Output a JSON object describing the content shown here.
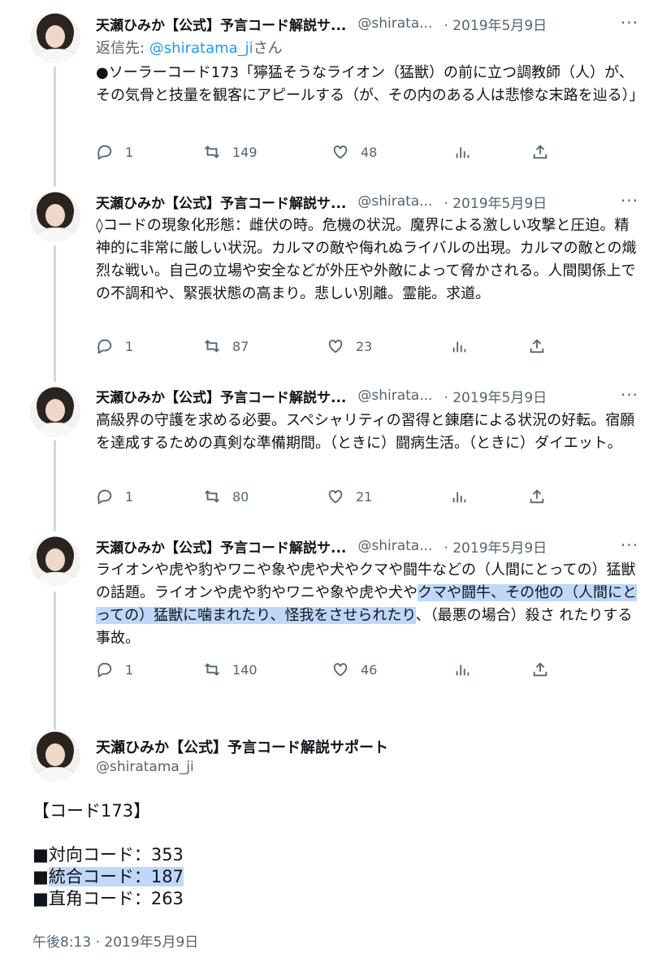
{
  "tweets": [
    {
      "name": "天瀬ひみか【公式】予言コード解説サ...",
      "handle": "@shirata...",
      "date": "· 2019年5月9日",
      "reply_prefix": "返信先: ",
      "reply_mention": "@shiratama_ji",
      "reply_suffix": "さん",
      "text": "●ソーラーコード173「獰猛そうなライオン（猛獣）の前に立つ調教師（人）が、その気骨と技量を観客にアピールする（が、その内のある人は悲惨な末路を辿る）」",
      "replies": "1",
      "retweets": "149",
      "likes": "48"
    },
    {
      "name": "天瀬ひみか【公式】予言コード解説サ...",
      "handle": "@shirata...",
      "date": "· 2019年5月9日",
      "text": "◊コードの現象化形態：雌伏の時。危機の状況。魔界による激しい攻撃と圧迫。精神的に非常に厳しい状況。カルマの敵や侮れぬライバルの出現。カルマの敵との熾烈な戦い。自己の立場や安全などが外圧や外敵によって脅かされる。人間関係上での不調和や、緊張状態の高まり。悲しい別離。霊能。求道。",
      "replies": "1",
      "retweets": "87",
      "likes": "23"
    },
    {
      "name": "天瀬ひみか【公式】予言コード解説サ...",
      "handle": "@shirata...",
      "date": "· 2019年5月9日",
      "text": "高級界の守護を求める必要。スペシャリティの習得と錬磨による状況の好転。宿願を達成するための真剣な準備期間。（ときに）闘病生活。（ときに）ダイエット。",
      "replies": "1",
      "retweets": "80",
      "likes": "21"
    },
    {
      "name": "天瀬ひみか【公式】予言コード解説サ...",
      "handle": "@shirata...",
      "date": "· 2019年5月9日",
      "text_a": "ライオンや虎や豹やワニや象や虎や犬やクマや闘牛などの（人間にとっての）猛獣の話題。ライオンや虎や豹やワニや象や虎や犬や",
      "text_hl": "クマや闘牛、その他の（人間にとっての）猛獣に噛まれたり、怪我をさせられたり",
      "text_b": "、（最悪の場合）殺さ れたりする事故。",
      "replies": "1",
      "retweets": "140",
      "likes": "46"
    }
  ],
  "main": {
    "name": "天瀬ひみか【公式】予言コード解説サポート",
    "handle": "@shiratama_ji",
    "line1": "【コード173】",
    "line2": "■対向コード：353",
    "line3_a": "■",
    "line3_hl": "統合コード：187",
    "line4": "■直角コード：263",
    "timestamp": "午後8:13 · 2019年5月9日"
  },
  "icons": [
    "reply-icon",
    "retweet-icon",
    "like-icon",
    "views-icon",
    "share-icon",
    "more-icon"
  ],
  "colors": {
    "secondary": "#536471",
    "link": "#1d9bf0",
    "highlight": "#bfd7f8",
    "thread": "#cfd9de"
  }
}
